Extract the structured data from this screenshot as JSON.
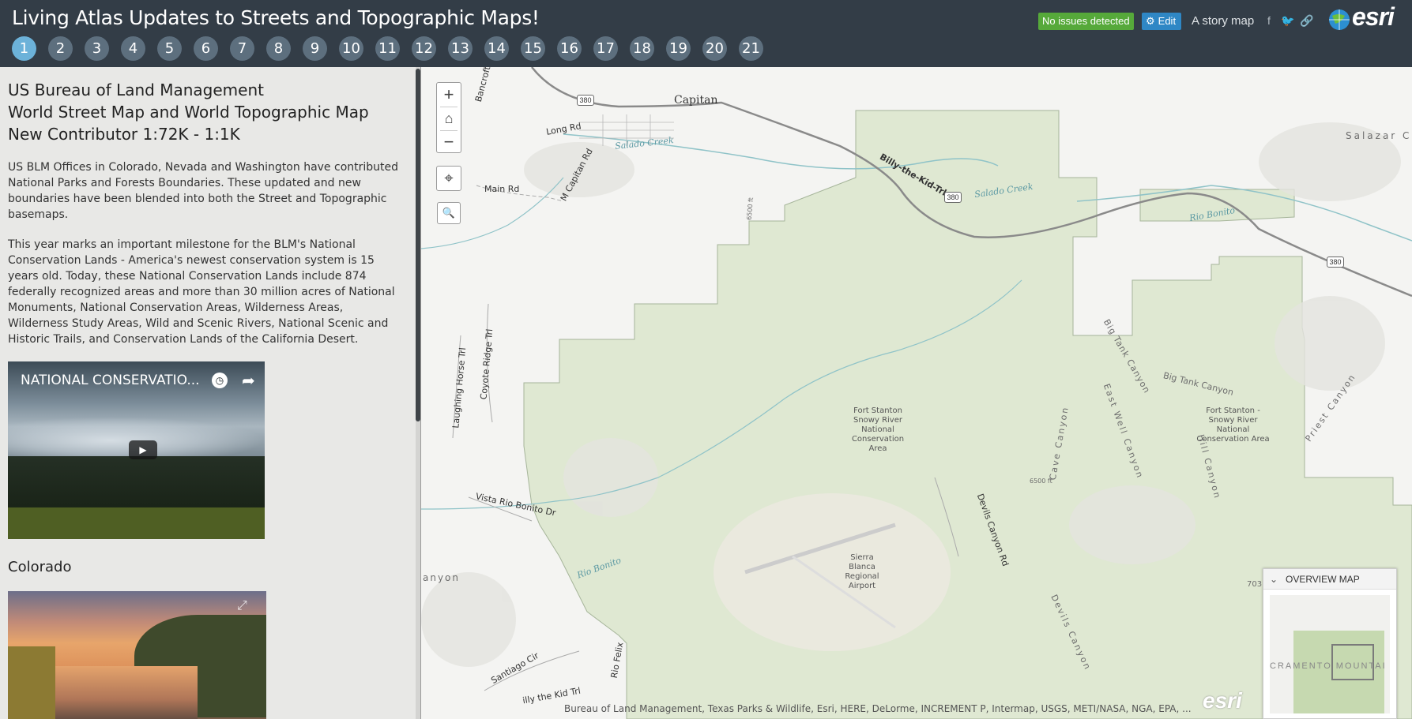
{
  "header": {
    "title": "Living Atlas Updates to Streets and Topographic Maps!",
    "tabs": [
      "1",
      "2",
      "3",
      "4",
      "5",
      "6",
      "7",
      "8",
      "9",
      "10",
      "11",
      "12",
      "13",
      "14",
      "15",
      "16",
      "17",
      "18",
      "19",
      "20",
      "21"
    ],
    "active_tab": "1",
    "status_badge": "No issues detected",
    "edit_label": "Edit",
    "story_map_label": "A story map",
    "logo_text": "esri",
    "colors": {
      "bar": "#333d47",
      "tab": "#5d6f7e",
      "tab_active": "#6cb2d9",
      "badge": "#56a93a",
      "edit": "#2f87c5"
    },
    "icons": [
      "facebook-icon",
      "twitter-icon",
      "link-icon",
      "globe-icon"
    ]
  },
  "side": {
    "title_line1": "US Bureau of Land Management",
    "title_line2": "World Street Map and World Topographic Map",
    "title_line3": "New Contributor 1:72K - 1:1K",
    "para1": "US BLM Offices in Colorado, Nevada and Washington have contributed National Parks and Forests Boundaries. These updated and new boundaries have been blended into both the Street and Topographic basemaps.",
    "para2": "This year marks an important milestone for the BLM's National Conservation Lands - America's newest conservation system is 15 years old. Today, these National Conservation Lands include 874 federally recognized areas and more than 30 million acres of National Monuments, National Conservation Areas, Wilderness Areas, Wilderness Study Areas, Wild and Scenic Rivers, National Scenic and Historic Trails, and Conservation Lands of the California Desert.",
    "video_title": "NATIONAL CONSERVATIO...",
    "section_colorado": "Colorado"
  },
  "map": {
    "labels": {
      "capitan": "Capitan",
      "long_rd": "Long Rd",
      "main_rd": "Main Rd",
      "mcaptain_rd": "M Capitan Rd",
      "bancroft": "Bancroft",
      "salado_creek": "Salado Creek",
      "salado_creek2": "Salado Creek",
      "billy_kid": "Billy-the-Kid-Trl",
      "billy_kid2": "illy the Kid Trl",
      "rio_bonito": "Rio Bonito",
      "rio_bonito2": "Rio Bonito",
      "salazar": "Salazar C",
      "big_tank": "Big Tank Canyon",
      "big_tank2": "Big Tank Canyon",
      "fort_stanton1": "Fort Stanton Snowy River National Conservation Area",
      "fort_stanton2": "Fort Stanton - Snowy River National Conservation Area",
      "east_well": "East Well Canyon",
      "cave_canyon": "Cave Canyon",
      "hill_canyon": "Hill Canyon",
      "priest_canyon": "Priest Canyon",
      "devils_canyon_rd": "Devils Canyon Rd",
      "devils_canyon": "Devils Canyon",
      "vista_rio": "Vista Rio Bonito Dr",
      "coyote_ridge": "Coyote Ridge Trl",
      "laughing_horse": "Laughing Horse Trl",
      "sierra_blanca": "Sierra Blanca Regional Airport",
      "santiago": "Santiago Cir",
      "rio_felix": "Rio Felix",
      "anyon": "anyon",
      "contour_6500": "6500 ft",
      "contour_6500b": "6500 ft",
      "r380a": "380",
      "r380b": "380",
      "r380c": "380",
      "r703": "703"
    },
    "overview_title": "OVERVIEW MAP",
    "overview_label": "CRAMENTO MOUNTAI",
    "attribution": "Bureau of Land Management, Texas Parks & Wildlife, Esri, HERE, DeLorme, INCREMENT P, Intermap, USGS, METI/NASA, NGA, EPA, ...",
    "powered_logo": "esri",
    "colors": {
      "land": "#f4f4f2",
      "conservation": "#dfe8d2",
      "water": "#8fc3c8",
      "road": "#888888"
    }
  }
}
